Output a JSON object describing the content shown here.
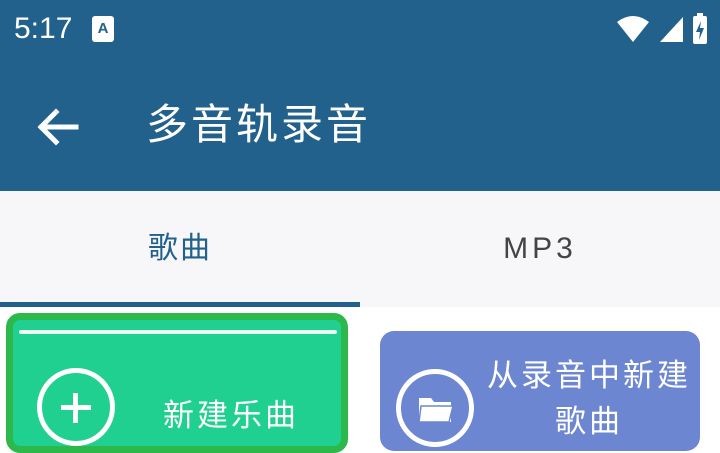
{
  "status_bar": {
    "time": "5:17",
    "notification_letter": "A"
  },
  "app_bar": {
    "title": "多音轨录音",
    "back_icon": "arrow-back-icon"
  },
  "tabs": [
    {
      "label": "歌曲",
      "selected": true
    },
    {
      "label": "MP3",
      "selected": false
    }
  ],
  "actions": {
    "new_song": {
      "label": "新建乐曲",
      "icon": "plus-icon"
    },
    "new_from_recording": {
      "label_line1": "从录音中新建",
      "label_line2": "歌曲",
      "icon": "folder-icon"
    }
  },
  "colors": {
    "primary": "#21618c",
    "green_card": "#20d090",
    "focus_border": "#2db84b",
    "blue_card": "#6d86d1"
  }
}
